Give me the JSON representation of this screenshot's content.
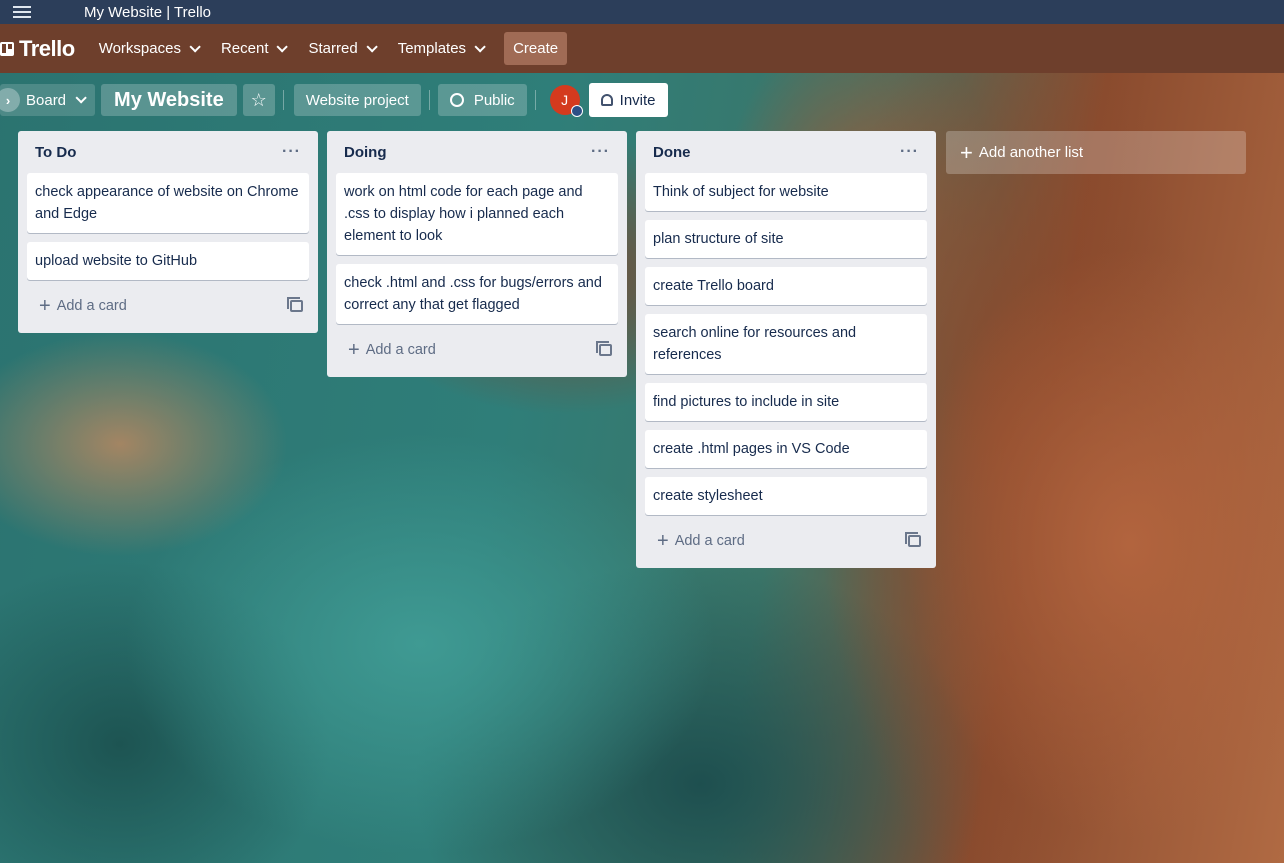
{
  "window": {
    "title": "My Website | Trello"
  },
  "header": {
    "logo": "Trello",
    "nav": [
      {
        "label": "Workspaces"
      },
      {
        "label": "Recent"
      },
      {
        "label": "Starred"
      },
      {
        "label": "Templates"
      }
    ],
    "create_label": "Create"
  },
  "boardbar": {
    "view_label": "Board",
    "board_name": "My Website",
    "workspace_label": "Website project",
    "visibility_label": "Public",
    "avatar_initial": "J",
    "invite_label": "Invite"
  },
  "lists": [
    {
      "title": "To Do",
      "menu": "···",
      "cards": [
        "check appearance of website on Chrome and Edge",
        "upload website to GitHub"
      ],
      "add_card_label": "Add a card"
    },
    {
      "title": "Doing",
      "menu": "···",
      "cards": [
        "work on html code for each page and .css to display how i planned each element to look",
        "check .html and .css for bugs/errors and correct any that get flagged"
      ],
      "add_card_label": "Add a card"
    },
    {
      "title": "Done",
      "menu": "···",
      "cards": [
        "Think of subject for website",
        "plan structure of site",
        "create Trello board",
        "search online for resources and references",
        "find pictures to include in site",
        "create .html pages in VS Code",
        "create stylesheet"
      ],
      "add_card_label": "Add a card"
    }
  ],
  "add_list_label": "Add another list",
  "colors": {
    "header": "#6e3f2c",
    "titlebar": "#2c3e5a",
    "avatar": "#d43a1e"
  }
}
